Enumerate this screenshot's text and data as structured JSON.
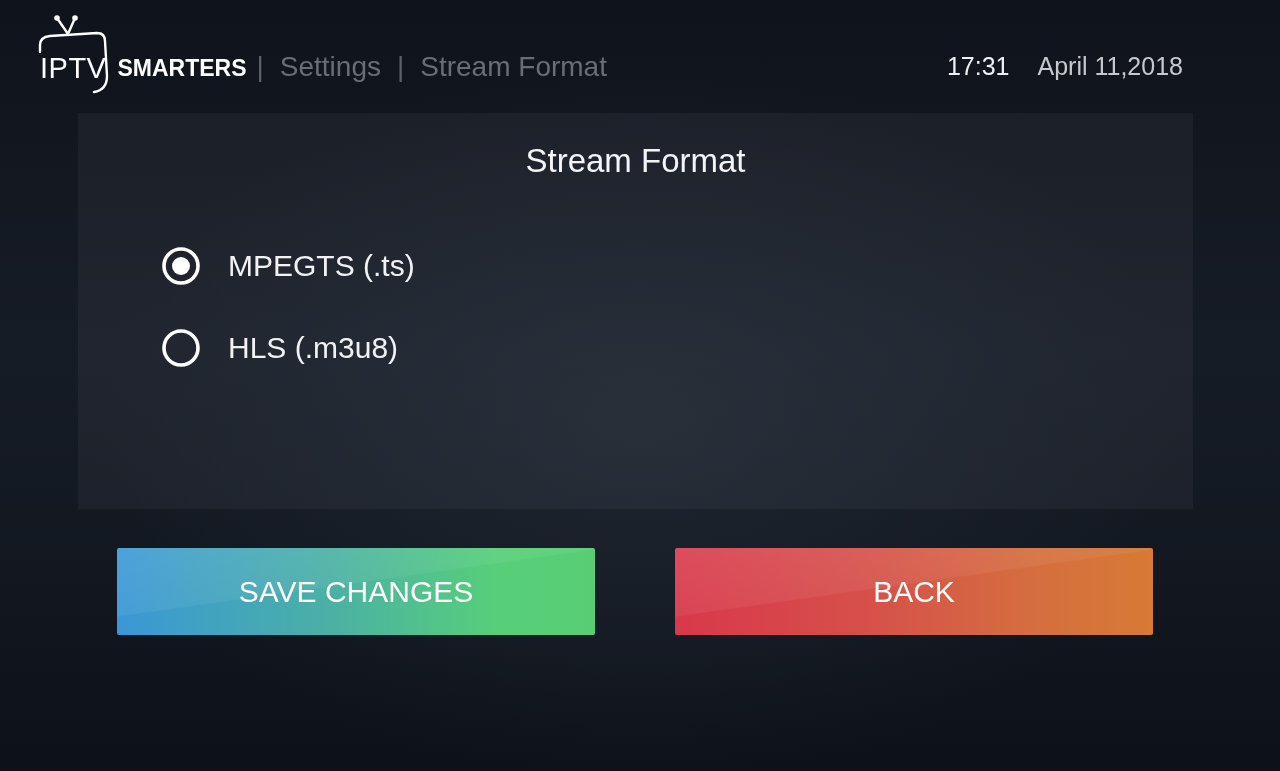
{
  "header": {
    "logo": {
      "light_text": "IPTV",
      "bold_text": "SMARTERS"
    },
    "breadcrumb": [
      {
        "kind": "separator",
        "text": "|"
      },
      {
        "kind": "crumb",
        "text": "Settings"
      },
      {
        "kind": "separator",
        "text": "|"
      },
      {
        "kind": "crumb",
        "text": "Stream Format"
      }
    ],
    "time": "17:31",
    "date": "April 11,2018"
  },
  "panel": {
    "title": "Stream Format",
    "options": [
      {
        "label": "MPEGTS (.ts)",
        "selected": true
      },
      {
        "label": "HLS (.m3u8)",
        "selected": false
      }
    ]
  },
  "buttons": [
    {
      "kind": "save",
      "label": "SAVE CHANGES"
    },
    {
      "kind": "back",
      "label": "BACK"
    }
  ]
}
